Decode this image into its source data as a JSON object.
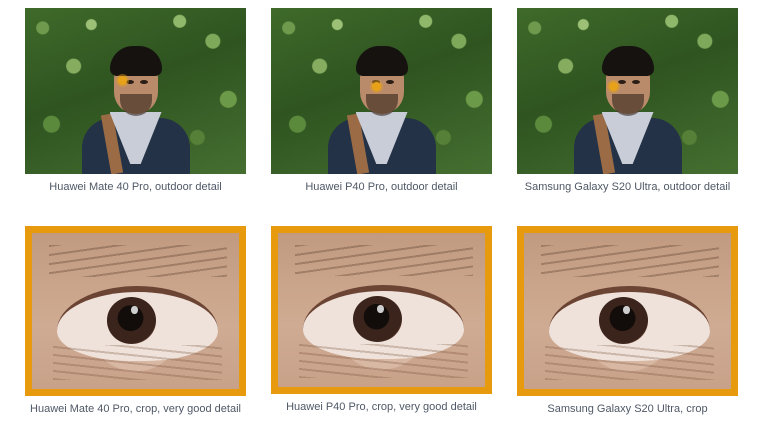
{
  "marker_color": "#e8a21a",
  "frame_color": "#e89a0e",
  "photos": [
    {
      "caption": "Huawei Mate 40 Pro, outdoor detail"
    },
    {
      "caption": "Huawei P40 Pro, outdoor detail"
    },
    {
      "caption": "Samsung Galaxy S20 Ultra, outdoor detail"
    }
  ],
  "crops": [
    {
      "caption": "Huawei Mate 40 Pro, crop, very good detail"
    },
    {
      "caption": "Huawei P40 Pro, crop, very good detail"
    },
    {
      "caption": "Samsung Galaxy S20 Ultra, crop"
    }
  ]
}
